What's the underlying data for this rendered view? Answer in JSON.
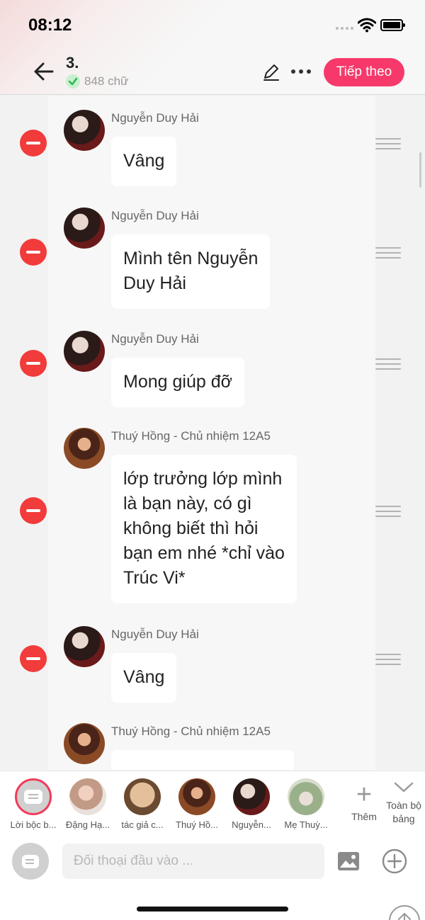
{
  "status": {
    "time": "08:12"
  },
  "header": {
    "title": "3.",
    "word_count": "848 chữ",
    "next_label": "Tiếp theo"
  },
  "messages": [
    {
      "speaker": "Nguyễn Duy Hải",
      "lines": [
        "Vâng"
      ]
    },
    {
      "speaker": "Nguyễn Duy Hải",
      "lines": [
        "Mình tên Nguyễn",
        "Duy Hải"
      ]
    },
    {
      "speaker": "Nguyễn Duy Hải",
      "lines": [
        "Mong giúp đỡ"
      ]
    },
    {
      "speaker": "Thuý Hồng - Chủ nhiệm 12A5",
      "lines": [
        "lớp trưởng lớp mình",
        "là bạn này, có gì",
        "không biết thì hỏi",
        "bạn em nhé *chỉ vào",
        "Trúc Vi*"
      ]
    },
    {
      "speaker": "Nguyễn Duy Hải",
      "lines": [
        "Vâng"
      ]
    },
    {
      "speaker": "Thuý Hồng - Chủ nhiệm 12A5",
      "lines": [
        ""
      ]
    }
  ],
  "cast": [
    {
      "label": "Lời bộc b..."
    },
    {
      "label": "Đặng Hạ..."
    },
    {
      "label": "tác giả c..."
    },
    {
      "label": "Thuý Hồ..."
    },
    {
      "label": "Nguyễn..."
    },
    {
      "label": "Mẹ Thuỳ..."
    }
  ],
  "cast_actions": {
    "add_label": "Thêm",
    "all_label": "Toàn bộ bảng"
  },
  "input": {
    "placeholder": "Đối thoại đầu vào ..."
  },
  "colors": {
    "accent": "#f6396a",
    "delete": "#f23b3b"
  },
  "icons": [
    "back-arrow-icon",
    "check-icon",
    "pencil-icon",
    "more-icon",
    "minus-icon",
    "drag-handle-icon",
    "plus-icon",
    "chevron-down-icon",
    "image-icon",
    "plus-circle-icon",
    "arrow-up-icon",
    "wifi-icon",
    "battery-icon"
  ]
}
